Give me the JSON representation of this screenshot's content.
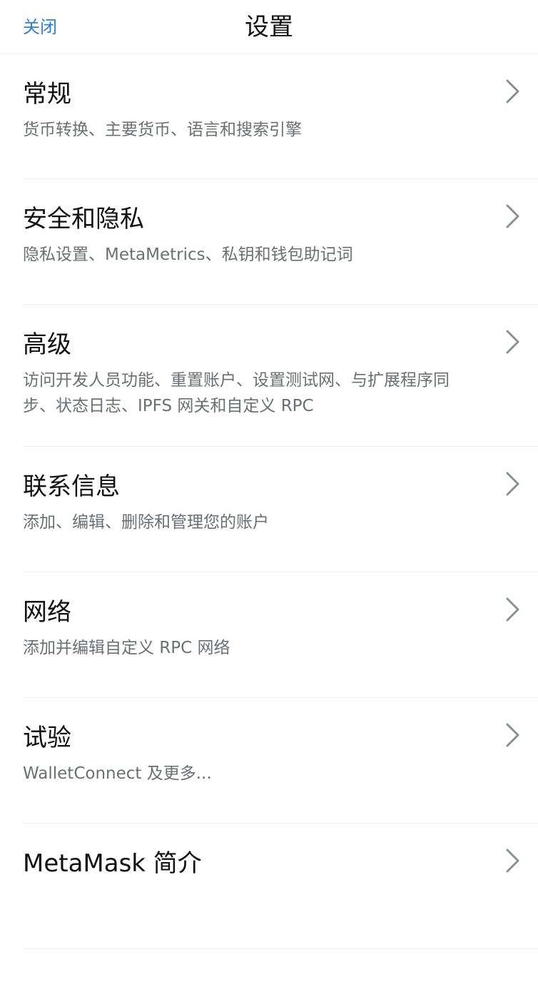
{
  "header": {
    "close_label": "关闭",
    "title": "设置"
  },
  "settings": {
    "items": [
      {
        "title": "常规",
        "desc": "货币转换、主要货币、语言和搜索引擎"
      },
      {
        "title": "安全和隐私",
        "desc": "隐私设置、MetaMetrics、私钥和钱包助记词"
      },
      {
        "title": "高级",
        "desc": "访问开发人员功能、重置账户、设置测试网、与扩展程序同步、状态日志、IPFS 网关和自定义 RPC"
      },
      {
        "title": "联系信息",
        "desc": "添加、编辑、删除和管理您的账户"
      },
      {
        "title": "网络",
        "desc": "添加并编辑自定义 RPC 网络"
      },
      {
        "title": "试验",
        "desc": "WalletConnect 及更多..."
      },
      {
        "title": "MetaMask 简介",
        "desc": ""
      }
    ]
  },
  "colors": {
    "accent": "#2f7fd1",
    "title_text": "#111111",
    "desc_text": "#6b6f75",
    "divider": "#eeeeee",
    "chevron": "#8a8f96"
  },
  "icons": {
    "row_chevron": "chevron-right-icon"
  }
}
